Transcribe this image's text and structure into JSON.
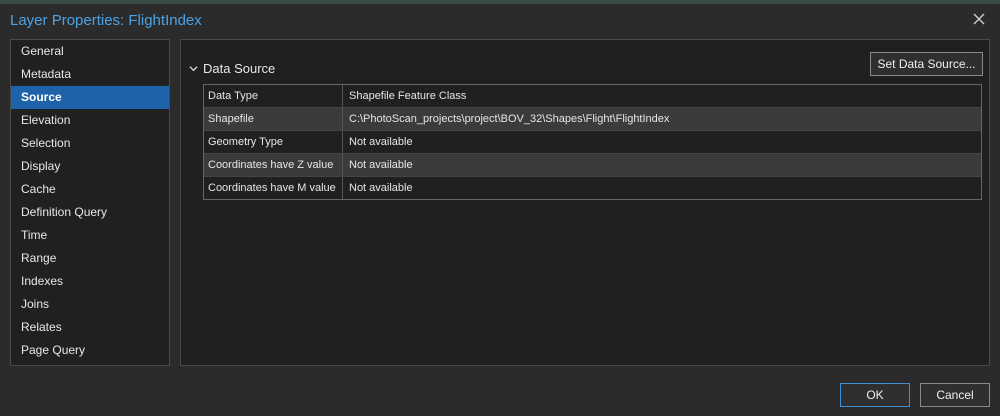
{
  "window": {
    "title": "Layer Properties: FlightIndex"
  },
  "sidebar": {
    "items": [
      {
        "label": "General"
      },
      {
        "label": "Metadata"
      },
      {
        "label": "Source"
      },
      {
        "label": "Elevation"
      },
      {
        "label": "Selection"
      },
      {
        "label": "Display"
      },
      {
        "label": "Cache"
      },
      {
        "label": "Definition Query"
      },
      {
        "label": "Time"
      },
      {
        "label": "Range"
      },
      {
        "label": "Indexes"
      },
      {
        "label": "Joins"
      },
      {
        "label": "Relates"
      },
      {
        "label": "Page Query"
      }
    ],
    "active_index": 2
  },
  "section": {
    "title": "Data Source",
    "expanded": true
  },
  "buttons": {
    "set_data_source": "Set Data Source...",
    "ok": "OK",
    "cancel": "Cancel"
  },
  "table": {
    "rows": [
      {
        "key": "Data Type",
        "value": "Shapefile Feature Class"
      },
      {
        "key": "Shapefile",
        "value": "C:\\PhotoScan_projects\\project\\BOV_32\\Shapes\\Flight\\FlightIndex"
      },
      {
        "key": "Geometry Type",
        "value": "Not available"
      },
      {
        "key": "Coordinates have Z value",
        "value": "Not available"
      },
      {
        "key": "Coordinates have M value",
        "value": "Not available"
      }
    ]
  },
  "colors": {
    "accent": "#1e62a9",
    "title": "#4aa3e8",
    "background": "#2b2b2b"
  }
}
